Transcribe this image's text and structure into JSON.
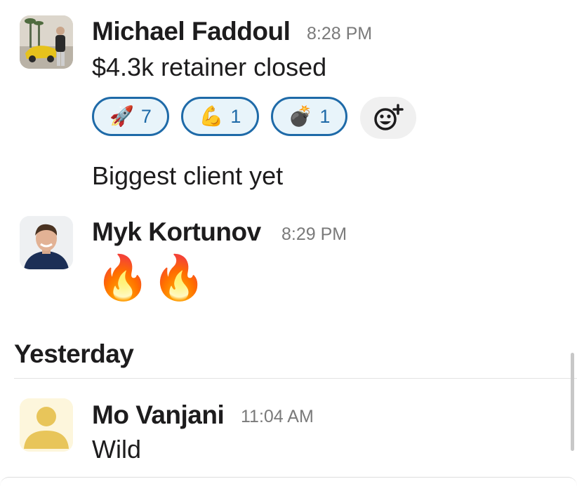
{
  "messages": [
    {
      "author": "Michael Faddoul",
      "time": "8:28 PM",
      "text": "$4.3k retainer closed",
      "reactions": [
        {
          "icon": "rocket-icon",
          "emoji": "🚀",
          "count": "7"
        },
        {
          "icon": "flexed-biceps-icon",
          "emoji": "💪",
          "count": "1"
        },
        {
          "icon": "bomb-icon",
          "emoji": "💣",
          "count": "1"
        }
      ],
      "followup": "Biggest client yet"
    },
    {
      "author": "Myk Kortunov",
      "time": "8:29 PM",
      "emojis": [
        "🔥",
        "🔥"
      ]
    }
  ],
  "section": {
    "title": "Yesterday"
  },
  "messages_yesterday": [
    {
      "author": "Mo Vanjani",
      "time": "11:04 AM",
      "text": "Wild"
    }
  ],
  "colors": {
    "reaction_border": "#1e6aa8",
    "reaction_bg": "#e8f4fa",
    "default_avatar_bg": "#fdf6dc",
    "default_avatar_fg": "#e8c55a"
  }
}
